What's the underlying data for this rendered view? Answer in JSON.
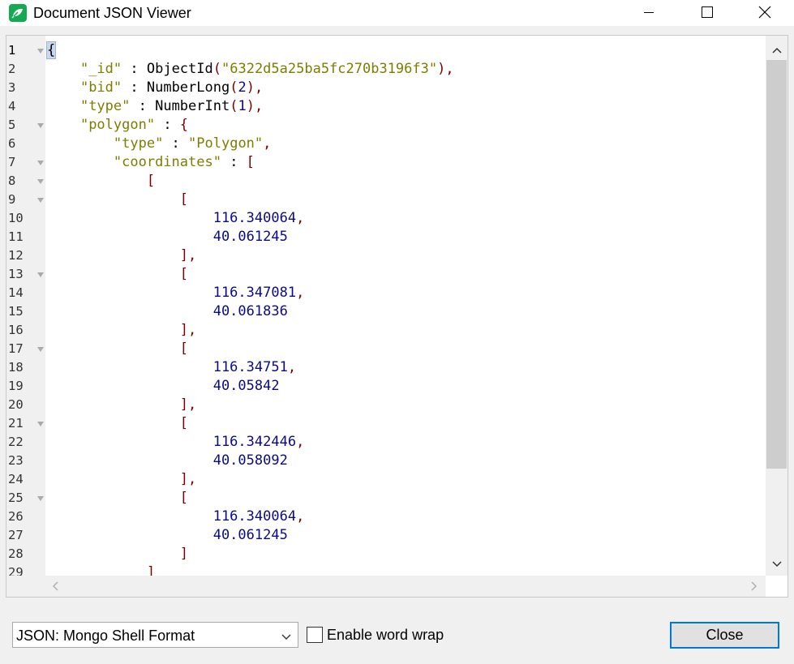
{
  "window": {
    "title": "Document JSON Viewer",
    "accent_color": "#0078d7",
    "app_icon_color": "#13aa52"
  },
  "editor": {
    "lines": [
      {
        "n": "1",
        "fold": true,
        "tokens": [
          {
            "t": "{",
            "c": "brace-hl"
          }
        ]
      },
      {
        "n": "2",
        "fold": false,
        "tokens": [
          {
            "t": "    ",
            "c": ""
          },
          {
            "t": "\"_id\"",
            "c": "key"
          },
          {
            "t": " : ",
            "c": "fn"
          },
          {
            "t": "ObjectId",
            "c": "fn"
          },
          {
            "t": "(",
            "c": "punct"
          },
          {
            "t": "\"6322d5a25ba5fc270b3196f3\"",
            "c": "str"
          },
          {
            "t": "),",
            "c": "punct"
          }
        ]
      },
      {
        "n": "3",
        "fold": false,
        "tokens": [
          {
            "t": "    ",
            "c": ""
          },
          {
            "t": "\"bid\"",
            "c": "key"
          },
          {
            "t": " : ",
            "c": "fn"
          },
          {
            "t": "NumberLong",
            "c": "fn"
          },
          {
            "t": "(",
            "c": "punct"
          },
          {
            "t": "2",
            "c": "num"
          },
          {
            "t": "),",
            "c": "punct"
          }
        ]
      },
      {
        "n": "4",
        "fold": false,
        "tokens": [
          {
            "t": "    ",
            "c": ""
          },
          {
            "t": "\"type\"",
            "c": "key"
          },
          {
            "t": " : ",
            "c": "fn"
          },
          {
            "t": "NumberInt",
            "c": "fn"
          },
          {
            "t": "(",
            "c": "punct"
          },
          {
            "t": "1",
            "c": "num"
          },
          {
            "t": "),",
            "c": "punct"
          }
        ]
      },
      {
        "n": "5",
        "fold": true,
        "tokens": [
          {
            "t": "    ",
            "c": ""
          },
          {
            "t": "\"polygon\"",
            "c": "key"
          },
          {
            "t": " : ",
            "c": "fn"
          },
          {
            "t": "{",
            "c": "bracket"
          }
        ]
      },
      {
        "n": "6",
        "fold": false,
        "tokens": [
          {
            "t": "        ",
            "c": ""
          },
          {
            "t": "\"type\"",
            "c": "key"
          },
          {
            "t": " : ",
            "c": "fn"
          },
          {
            "t": "\"Polygon\"",
            "c": "str"
          },
          {
            "t": ",",
            "c": "punct"
          }
        ]
      },
      {
        "n": "7",
        "fold": true,
        "tokens": [
          {
            "t": "        ",
            "c": ""
          },
          {
            "t": "\"coordinates\"",
            "c": "key"
          },
          {
            "t": " : ",
            "c": "fn"
          },
          {
            "t": "[",
            "c": "bracket"
          }
        ]
      },
      {
        "n": "8",
        "fold": true,
        "tokens": [
          {
            "t": "            ",
            "c": ""
          },
          {
            "t": "[",
            "c": "bracket"
          }
        ]
      },
      {
        "n": "9",
        "fold": true,
        "tokens": [
          {
            "t": "                ",
            "c": ""
          },
          {
            "t": "[",
            "c": "bracket"
          }
        ]
      },
      {
        "n": "10",
        "fold": false,
        "tokens": [
          {
            "t": "                    ",
            "c": ""
          },
          {
            "t": "116.340064",
            "c": "num"
          },
          {
            "t": ",",
            "c": "punct"
          }
        ]
      },
      {
        "n": "11",
        "fold": false,
        "tokens": [
          {
            "t": "                    ",
            "c": ""
          },
          {
            "t": "40.061245",
            "c": "num"
          }
        ]
      },
      {
        "n": "12",
        "fold": false,
        "tokens": [
          {
            "t": "                ",
            "c": ""
          },
          {
            "t": "],",
            "c": "bracket"
          }
        ]
      },
      {
        "n": "13",
        "fold": true,
        "tokens": [
          {
            "t": "                ",
            "c": ""
          },
          {
            "t": "[",
            "c": "bracket"
          }
        ]
      },
      {
        "n": "14",
        "fold": false,
        "tokens": [
          {
            "t": "                    ",
            "c": ""
          },
          {
            "t": "116.347081",
            "c": "num"
          },
          {
            "t": ",",
            "c": "punct"
          }
        ]
      },
      {
        "n": "15",
        "fold": false,
        "tokens": [
          {
            "t": "                    ",
            "c": ""
          },
          {
            "t": "40.061836",
            "c": "num"
          }
        ]
      },
      {
        "n": "16",
        "fold": false,
        "tokens": [
          {
            "t": "                ",
            "c": ""
          },
          {
            "t": "],",
            "c": "bracket"
          }
        ]
      },
      {
        "n": "17",
        "fold": true,
        "tokens": [
          {
            "t": "                ",
            "c": ""
          },
          {
            "t": "[",
            "c": "bracket"
          }
        ]
      },
      {
        "n": "18",
        "fold": false,
        "tokens": [
          {
            "t": "                    ",
            "c": ""
          },
          {
            "t": "116.34751",
            "c": "num"
          },
          {
            "t": ",",
            "c": "punct"
          }
        ]
      },
      {
        "n": "19",
        "fold": false,
        "tokens": [
          {
            "t": "                    ",
            "c": ""
          },
          {
            "t": "40.05842",
            "c": "num"
          }
        ]
      },
      {
        "n": "20",
        "fold": false,
        "tokens": [
          {
            "t": "                ",
            "c": ""
          },
          {
            "t": "],",
            "c": "bracket"
          }
        ]
      },
      {
        "n": "21",
        "fold": true,
        "tokens": [
          {
            "t": "                ",
            "c": ""
          },
          {
            "t": "[",
            "c": "bracket"
          }
        ]
      },
      {
        "n": "22",
        "fold": false,
        "tokens": [
          {
            "t": "                    ",
            "c": ""
          },
          {
            "t": "116.342446",
            "c": "num"
          },
          {
            "t": ",",
            "c": "punct"
          }
        ]
      },
      {
        "n": "23",
        "fold": false,
        "tokens": [
          {
            "t": "                    ",
            "c": ""
          },
          {
            "t": "40.058092",
            "c": "num"
          }
        ]
      },
      {
        "n": "24",
        "fold": false,
        "tokens": [
          {
            "t": "                ",
            "c": ""
          },
          {
            "t": "],",
            "c": "bracket"
          }
        ]
      },
      {
        "n": "25",
        "fold": true,
        "tokens": [
          {
            "t": "                ",
            "c": ""
          },
          {
            "t": "[",
            "c": "bracket"
          }
        ]
      },
      {
        "n": "26",
        "fold": false,
        "tokens": [
          {
            "t": "                    ",
            "c": ""
          },
          {
            "t": "116.340064",
            "c": "num"
          },
          {
            "t": ",",
            "c": "punct"
          }
        ]
      },
      {
        "n": "27",
        "fold": false,
        "tokens": [
          {
            "t": "                    ",
            "c": ""
          },
          {
            "t": "40.061245",
            "c": "num"
          }
        ]
      },
      {
        "n": "28",
        "fold": false,
        "tokens": [
          {
            "t": "                ",
            "c": ""
          },
          {
            "t": "]",
            "c": "bracket"
          }
        ]
      },
      {
        "n": "29",
        "fold": false,
        "tokens": [
          {
            "t": "            ",
            "c": ""
          },
          {
            "t": "]",
            "c": "bracket"
          }
        ]
      }
    ],
    "vertical_scroll_fraction": 0
  },
  "footer": {
    "format_selected": "JSON: Mongo Shell Format",
    "word_wrap_label": "Enable word wrap",
    "word_wrap_checked": false,
    "close_label": "Close"
  }
}
